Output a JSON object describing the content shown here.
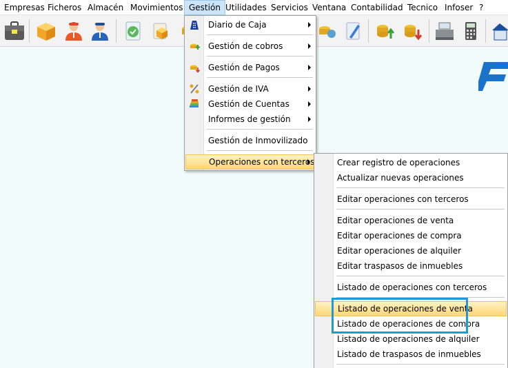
{
  "menubar": {
    "items": [
      "Empresas",
      "Ficheros",
      "Almacén",
      "Movimientos",
      "Gestión",
      "Utilidades",
      "Servicios",
      "Ventana",
      "Contabilidad",
      "Tecnico",
      "Infoser",
      "?"
    ],
    "active": "Gestión"
  },
  "toolbar": {
    "icons": [
      "briefcase-icon",
      "box-icon",
      "user-red-icon",
      "user-blue-icon",
      "document-check-icon",
      "box-small-icon",
      "coins-icon",
      "pen-icon",
      "coins-up-icon",
      "coins-down-icon",
      "cash-register-icon",
      "calculator-icon",
      "house-icon"
    ]
  },
  "gestion_menu": {
    "items": [
      {
        "label": "Diario de Caja",
        "icon": "building-icon",
        "submenu": true
      },
      {
        "label": "Gestión de cobros",
        "icon": "coins-plus-icon",
        "submenu": true
      },
      {
        "label": "Gestión de Pagos",
        "icon": "coins-minus-icon",
        "submenu": true
      },
      {
        "label": "Gestión de IVA",
        "icon": "percent-icon",
        "submenu": true
      },
      {
        "label": "Gestión de Cuentas",
        "icon": "books-icon",
        "submenu": true
      },
      {
        "label": "Informes de gestión",
        "icon": "",
        "submenu": true
      },
      {
        "label": "Gestión de Inmovilizado",
        "icon": "",
        "submenu": false
      },
      {
        "label": "Operaciones con terceros",
        "icon": "",
        "submenu": true,
        "highlighted": true
      }
    ]
  },
  "terceros_submenu": {
    "items": [
      "Crear registro de operaciones",
      "Actualizar nuevas operaciones",
      "Editar operaciones con terceros",
      "Editar operaciones de venta",
      "Editar operaciones de compra",
      "Editar operaciones de alquiler",
      "Editar traspasos de inmuebles",
      "Listado de operaciones con terceros",
      "Listado de operaciones de venta",
      "Listado de operaciones de compra",
      "Listado de operaciones de alquiler",
      "Listado de traspasos de inmuebles"
    ],
    "highlighted": "Listado de operaciones de venta"
  },
  "colors": {
    "background": "#f0fbfa",
    "highlight": "#ffd777",
    "focus_box": "#1e9ad6",
    "logo": "#1a73c9"
  }
}
